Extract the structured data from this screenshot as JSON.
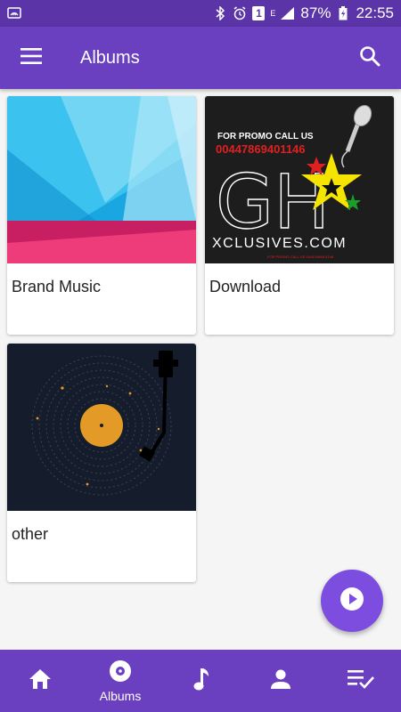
{
  "status_bar": {
    "battery": "87%",
    "time": "22:55",
    "notification_badge": "1",
    "network_type": "E"
  },
  "app_bar": {
    "title": "Albums",
    "menu_icon": "hamburger-menu-icon",
    "search_icon": "search-icon"
  },
  "albums": [
    {
      "name": "Brand Music",
      "art": "abstract-blue-pink"
    },
    {
      "name": "Download",
      "art": "gh-xclusives-promo",
      "art_text": {
        "promo": "FOR PROMO CALL US",
        "phone": "00447869401146",
        "logo": "GH",
        "site": "XCLUSIVES.COM",
        "small": "FOR PROMO CALL US 00447869401146"
      }
    },
    {
      "name": "other",
      "art": "vinyl-record"
    }
  ],
  "fab": {
    "icon": "play-icon"
  },
  "bottom_nav": {
    "items": [
      {
        "id": "home",
        "icon": "home-icon",
        "label": ""
      },
      {
        "id": "albums",
        "icon": "album-icon",
        "label": "Albums"
      },
      {
        "id": "songs",
        "icon": "music-note-icon",
        "label": ""
      },
      {
        "id": "artists",
        "icon": "person-icon",
        "label": ""
      },
      {
        "id": "playlists",
        "icon": "playlist-check-icon",
        "label": ""
      }
    ]
  },
  "colors": {
    "status_bar": "#5b34a8",
    "primary": "#6a3fc0",
    "accent": "#7c4ddf",
    "background": "#f5f5f5"
  }
}
